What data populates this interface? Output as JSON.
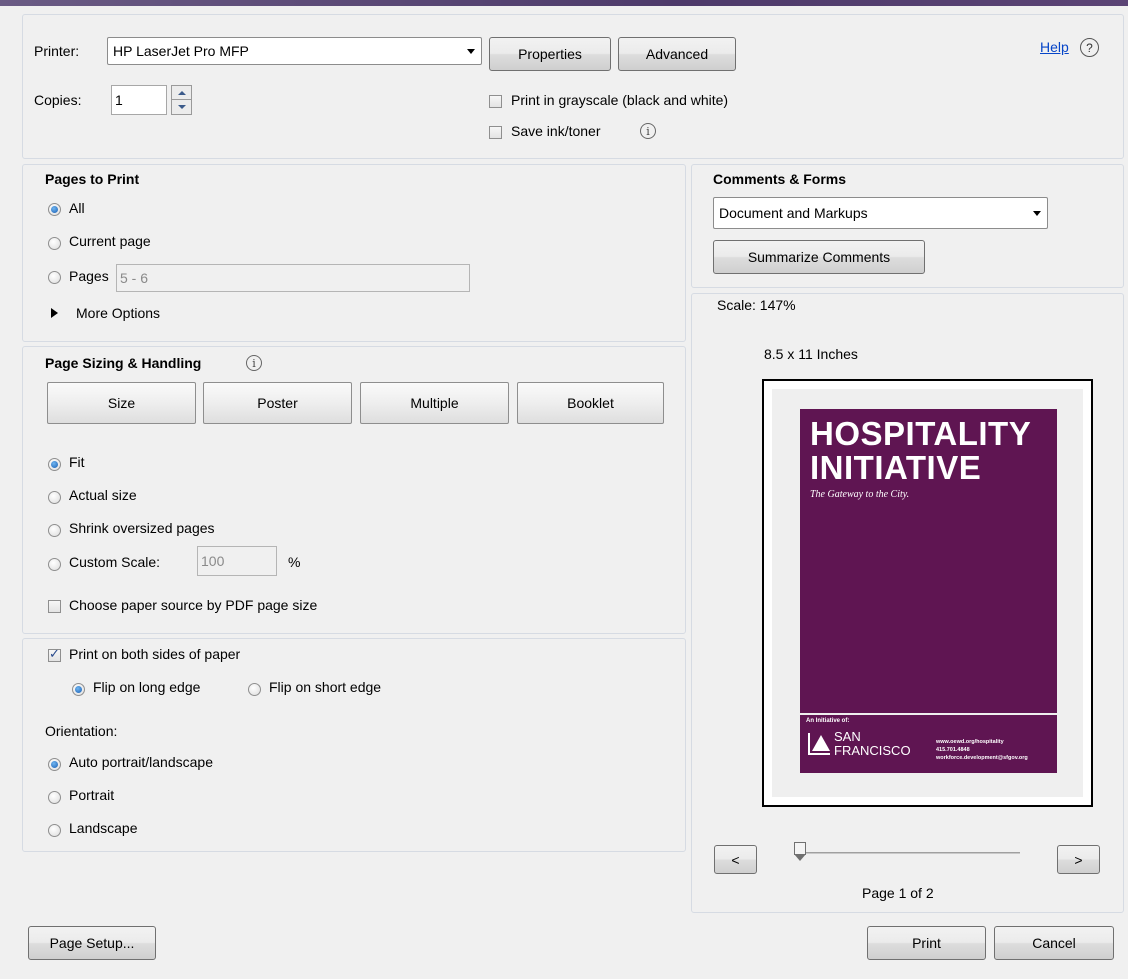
{
  "printer": {
    "label": "Printer:",
    "selected": "HP LaserJet Pro MFP",
    "properties_label": "Properties",
    "advanced_label": "Advanced",
    "help_label": "Help",
    "help_icon": "?"
  },
  "copies": {
    "label": "Copies:",
    "value": "1"
  },
  "options": {
    "grayscale_label": "Print in grayscale (black and white)",
    "grayscale_checked": false,
    "save_ink_label": "Save ink/toner",
    "save_ink_checked": false,
    "info_icon": "i"
  },
  "pages_to_print": {
    "title": "Pages to Print",
    "all_label": "All",
    "current_label": "Current page",
    "pages_label": "Pages",
    "pages_value": "5 - 6",
    "more_options_label": "More Options",
    "selected": "All"
  },
  "page_sizing": {
    "title": "Page Sizing & Handling",
    "info_icon": "i",
    "buttons": [
      "Size",
      "Poster",
      "Multiple",
      "Booklet"
    ],
    "fit_label": "Fit",
    "actual_label": "Actual size",
    "shrink_label": "Shrink oversized pages",
    "custom_label": "Custom Scale:",
    "custom_value": "100",
    "percent": "%",
    "paper_source_label": "Choose paper source by PDF page size",
    "selected": "Fit"
  },
  "duplex": {
    "both_sides_label": "Print on both sides of paper",
    "both_sides_checked": true,
    "long_edge_label": "Flip on long edge",
    "short_edge_label": "Flip on short edge",
    "selected": "Flip on long edge"
  },
  "orientation": {
    "title": "Orientation:",
    "auto_label": "Auto portrait/landscape",
    "portrait_label": "Portrait",
    "landscape_label": "Landscape",
    "selected": "Auto portrait/landscape"
  },
  "comments_forms": {
    "title": "Comments & Forms",
    "selected": "Document and Markups",
    "summarize_label": "Summarize Comments"
  },
  "preview": {
    "scale_label": "Scale: 147%",
    "paper_size": "8.5 x 11 Inches",
    "doc_title_line1": "HOSPITALITY",
    "doc_title_line2": "INITIATIVE",
    "doc_subtitle": "The Gateway to the City.",
    "footer_initiative": "An Initiative of:",
    "footer_logo_line1": "SAN",
    "footer_logo_line2": "FRANCISCO",
    "footer_contact_1": "www.oewd.org/hospitality",
    "footer_contact_2": "415.701.4848",
    "footer_contact_3": "workforce.development@sfgov.org",
    "prev_label": "<",
    "next_label": ">",
    "page_indicator": "Page 1 of 2",
    "slider_fraction": 0
  },
  "footer": {
    "page_setup_label": "Page Setup...",
    "print_label": "Print",
    "cancel_label": "Cancel"
  },
  "colors": {
    "doc_purple": "#5f1552",
    "title_bar": "#4d3a6a",
    "link": "#0645c8"
  }
}
